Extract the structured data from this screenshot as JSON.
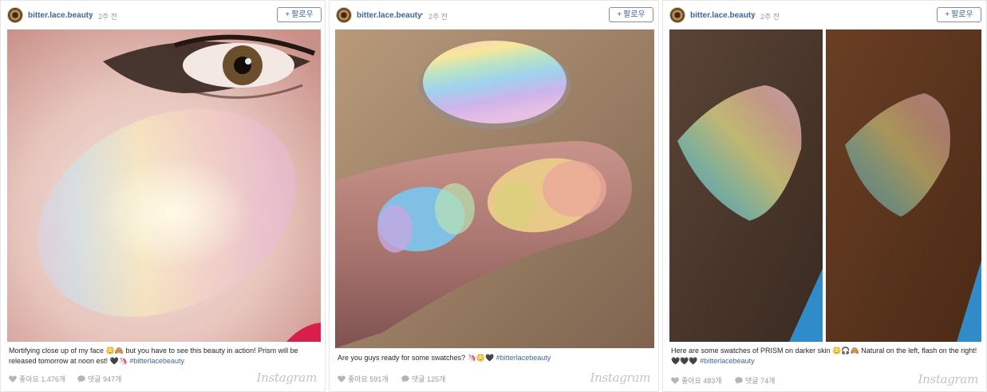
{
  "posts": [
    {
      "username": "bitter.lace.beauty",
      "dot": "•",
      "time": "2주 전",
      "follow_label": "팔로우",
      "follow_plus": "+",
      "caption_text": "Mortifying close up of my face 😳🙈 but you have to see this beauty in action! Prism will be released tomorrow at noon est! 🖤🦄 ",
      "hashtag": "#bitterlacebeauty",
      "likes": "좋아요 1,476개",
      "comments": "댓글 947개",
      "brand": "Instagram"
    },
    {
      "username": "bitter.lace.beauty",
      "dot": "•",
      "time": "2주 전",
      "follow_label": "팔로우",
      "follow_plus": "+",
      "caption_text": "Are you guys ready for some swatches? 🦄😳🖤 ",
      "hashtag": "#bitterlacebeauty",
      "likes": "좋아요 591개",
      "comments": "댓글 125개",
      "brand": "Instagram"
    },
    {
      "username": "bitter.lace.beauty",
      "dot": "•",
      "time": "2주 전",
      "follow_label": "팔로우",
      "follow_plus": "+",
      "caption_text": "Here are some swatches of PRISM on darker skin 😳🎧🙈 Natural on the left, flash on the right! 🖤🖤🖤 ",
      "hashtag": "#bitterlacebeauty",
      "likes": "좋아요 483개",
      "comments": "댓글 74개",
      "brand": "Instagram"
    }
  ],
  "colors": {
    "link": "#3f6894",
    "muted": "#999999",
    "border": "#e6e6e6"
  },
  "icons": [
    "avatar-image",
    "heart-icon",
    "comment-icon",
    "instagram-logo"
  ]
}
